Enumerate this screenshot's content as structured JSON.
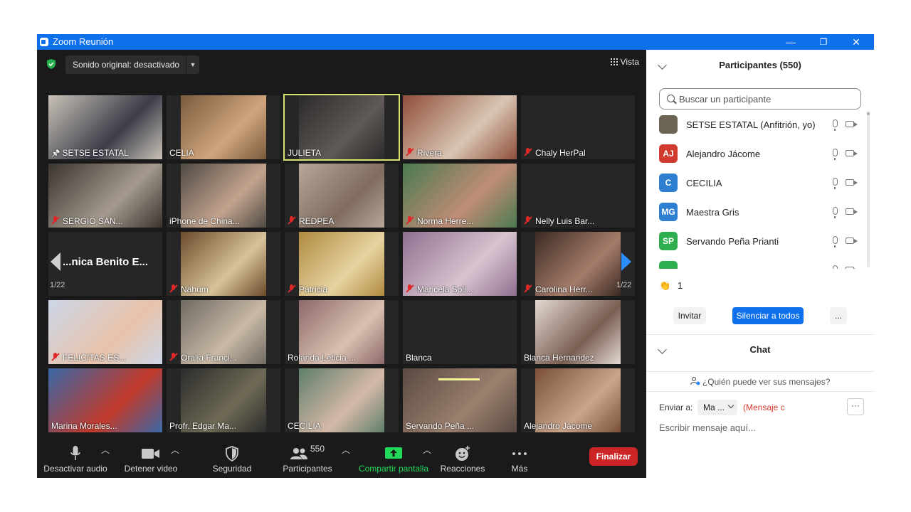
{
  "window": {
    "title": "Zoom Reunión",
    "min": "—",
    "restore": "❐",
    "close": "✕"
  },
  "meeting": {
    "sound_label": "Sonido original: desactivado",
    "view_label": "Vista",
    "page_left": "1/22",
    "page_right": "1/22"
  },
  "tiles": [
    {
      "name": "SETSE ESTATAL",
      "icon": "pin",
      "active": false,
      "c1": "#c9c2b8",
      "c2": "#3c3d48"
    },
    {
      "name": "CELIA",
      "icon": "none",
      "active": false,
      "c1": "#7a5a3d",
      "c2": "#cfa57d"
    },
    {
      "name": "JULIETA",
      "icon": "none",
      "active": true,
      "c1": "#2c2a2a",
      "c2": "#5f5a57"
    },
    {
      "name": "Rivera",
      "icon": "muted",
      "active": false,
      "c1": "#8e4e3a",
      "c2": "#d9c5b3"
    },
    {
      "name": "Chaly HerPal",
      "icon": "muted",
      "active": false,
      "c1": "#262626",
      "c2": "#262626"
    },
    {
      "name": "SERGIO SAN...",
      "icon": "muted",
      "active": false,
      "c1": "#3a3430",
      "c2": "#a49a8d"
    },
    {
      "name": "iPhone de China...",
      "icon": "none",
      "active": false,
      "c1": "#4f4a44",
      "c2": "#c2a38d"
    },
    {
      "name": "REDPEA",
      "icon": "muted",
      "active": false,
      "c1": "#b7a79a",
      "c2": "#7f6c5e"
    },
    {
      "name": "Norma Herre...",
      "icon": "muted",
      "active": false,
      "c1": "#4a7a4f",
      "c2": "#c08c77"
    },
    {
      "name": "Nelly Luis Bar...",
      "icon": "muted",
      "active": false,
      "c1": "#262626",
      "c2": "#262626"
    },
    {
      "name": "",
      "icon": "none",
      "active": false,
      "big": "...nica Benito E...",
      "c1": "#262626",
      "c2": "#262626"
    },
    {
      "name": "Nahum",
      "icon": "muted",
      "active": false,
      "c1": "#6b4b2a",
      "c2": "#d7c29a"
    },
    {
      "name": "Patricia",
      "icon": "muted",
      "active": false,
      "c1": "#b08a3f",
      "c2": "#e6d3a1"
    },
    {
      "name": "Maricela Soli...",
      "icon": "muted",
      "active": false,
      "c1": "#8f6f8f",
      "c2": "#d8c4d0"
    },
    {
      "name": "Carolina Herr...",
      "icon": "muted",
      "active": false,
      "c1": "#3b2a22",
      "c2": "#a57c6a"
    },
    {
      "name": "FELICITAS ES...",
      "icon": "muted",
      "active": false,
      "c1": "#cdd7e8",
      "c2": "#e8c2aa"
    },
    {
      "name": "Oralia Franci...",
      "icon": "muted",
      "active": false,
      "c1": "#6f6a62",
      "c2": "#c9b9a6"
    },
    {
      "name": "Rolanda Leticia ...",
      "icon": "none",
      "active": false,
      "c1": "#8c6a6a",
      "c2": "#d9c0b0"
    },
    {
      "name": "Blanca",
      "icon": "none",
      "active": false,
      "c1": "#262626",
      "c2": "#262626"
    },
    {
      "name": "Blanca Hernandez",
      "icon": "none",
      "active": false,
      "c1": "#e3d9d2",
      "c2": "#7a5e52"
    },
    {
      "name": "Marina Morales...",
      "icon": "none",
      "active": false,
      "c1": "#3a68a8",
      "c2": "#c23a2a"
    },
    {
      "name": "Profr. Edgar Ma...",
      "icon": "none",
      "active": false,
      "c1": "#2c2c2c",
      "c2": "#6f6a55"
    },
    {
      "name": "CECILIA",
      "icon": "none",
      "active": false,
      "c1": "#5f7f6a",
      "c2": "#d5b8a8"
    },
    {
      "name": "Servando Peña ...",
      "icon": "none",
      "active": false,
      "c1": "#5a4a42",
      "c2": "#9a7f6d"
    },
    {
      "name": "Alejandro Jácome",
      "icon": "none",
      "active": false,
      "c1": "#7a4f3a",
      "c2": "#c9a58a"
    }
  ],
  "toolbar": {
    "audio": "Desactivar audio",
    "video": "Detener video",
    "security": "Seguridad",
    "participants": "Participantes",
    "participants_count": "550",
    "share": "Compartir pantalla",
    "reactions": "Reacciones",
    "more": "Más",
    "end": "Finalizar"
  },
  "panel": {
    "title": "Participantes (550)",
    "search_placeholder": "Buscar un participante",
    "participants": [
      {
        "name": "SETSE ESTATAL (Anfitrión, yo)",
        "initials": "",
        "color": "#6b6353"
      },
      {
        "name": "Alejandro Jácome",
        "initials": "AJ",
        "color": "#d13b2e"
      },
      {
        "name": "CECILIA",
        "initials": "C",
        "color": "#2f7fd1"
      },
      {
        "name": "Maestra Gris",
        "initials": "MG",
        "color": "#2f7fd1"
      },
      {
        "name": "Servando Peña Prianti",
        "initials": "SP",
        "color": "#2eae4e"
      },
      {
        "name": "",
        "initials": "",
        "color": "#2eae4e"
      }
    ],
    "reaction_emoji": "👏",
    "reaction_count": "1",
    "invite": "Invitar",
    "mute_all": "Silenciar a todos",
    "more": "...",
    "chat_title": "Chat",
    "who_sees": "¿Quién puede ver sus mensajes?",
    "send_to": "Enviar a:",
    "recipient": "Ma ...",
    "message_note": "(Mensaje c",
    "chat_more": "···",
    "compose_placeholder": "Escribir mensaje aquí..."
  }
}
